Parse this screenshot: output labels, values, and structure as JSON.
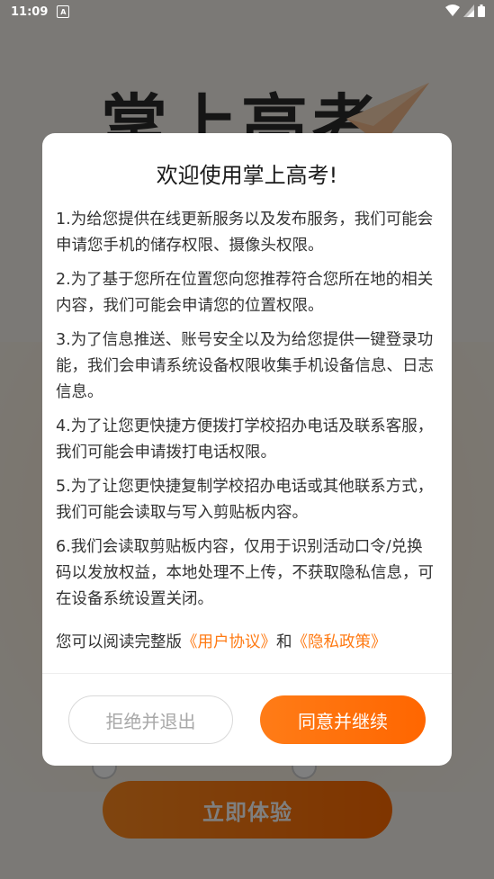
{
  "status_bar": {
    "time": "11:09",
    "notification_badge": "A"
  },
  "background": {
    "app_title": "掌上高考",
    "cta_label": "立即体验"
  },
  "dialog": {
    "title": "欢迎使用掌上高考!",
    "items": [
      "1.为给您提供在线更新服务以及发布服务，我们可能会申请您手机的储存权限、摄像头权限。",
      "2.为了基于您所在位置您向您推荐符合您所在地的相关内容，我们可能会申请您的位置权限。",
      "3.为了信息推送、账号安全以及为给您提供一键登录功能，我们会申请系统设备权限收集手机设备信息、日志信息。",
      "4.为了让您更快捷方便拨打学校招办电话及联系客服，我们可能会申请拨打电话权限。",
      "5.为了让您更快捷复制学校招办电话或其他联系方式，我们可能会读取与写入剪贴板内容。",
      "6.我们会读取剪贴板内容，仅用于识别活动口令/兑换码以发放权益，本地处理不上传，不获取隐私信息，可在设备系统设置关闭。"
    ],
    "read_prefix": "您可以阅读完整版",
    "user_agreement_link": "《用户协议》",
    "and_text": "和",
    "privacy_policy_link": "《隐私政策》",
    "reject_label": "拒绝并退出",
    "agree_label": "同意并继续"
  },
  "colors": {
    "accent": "#ff6a00",
    "link": "#ff7a13"
  }
}
